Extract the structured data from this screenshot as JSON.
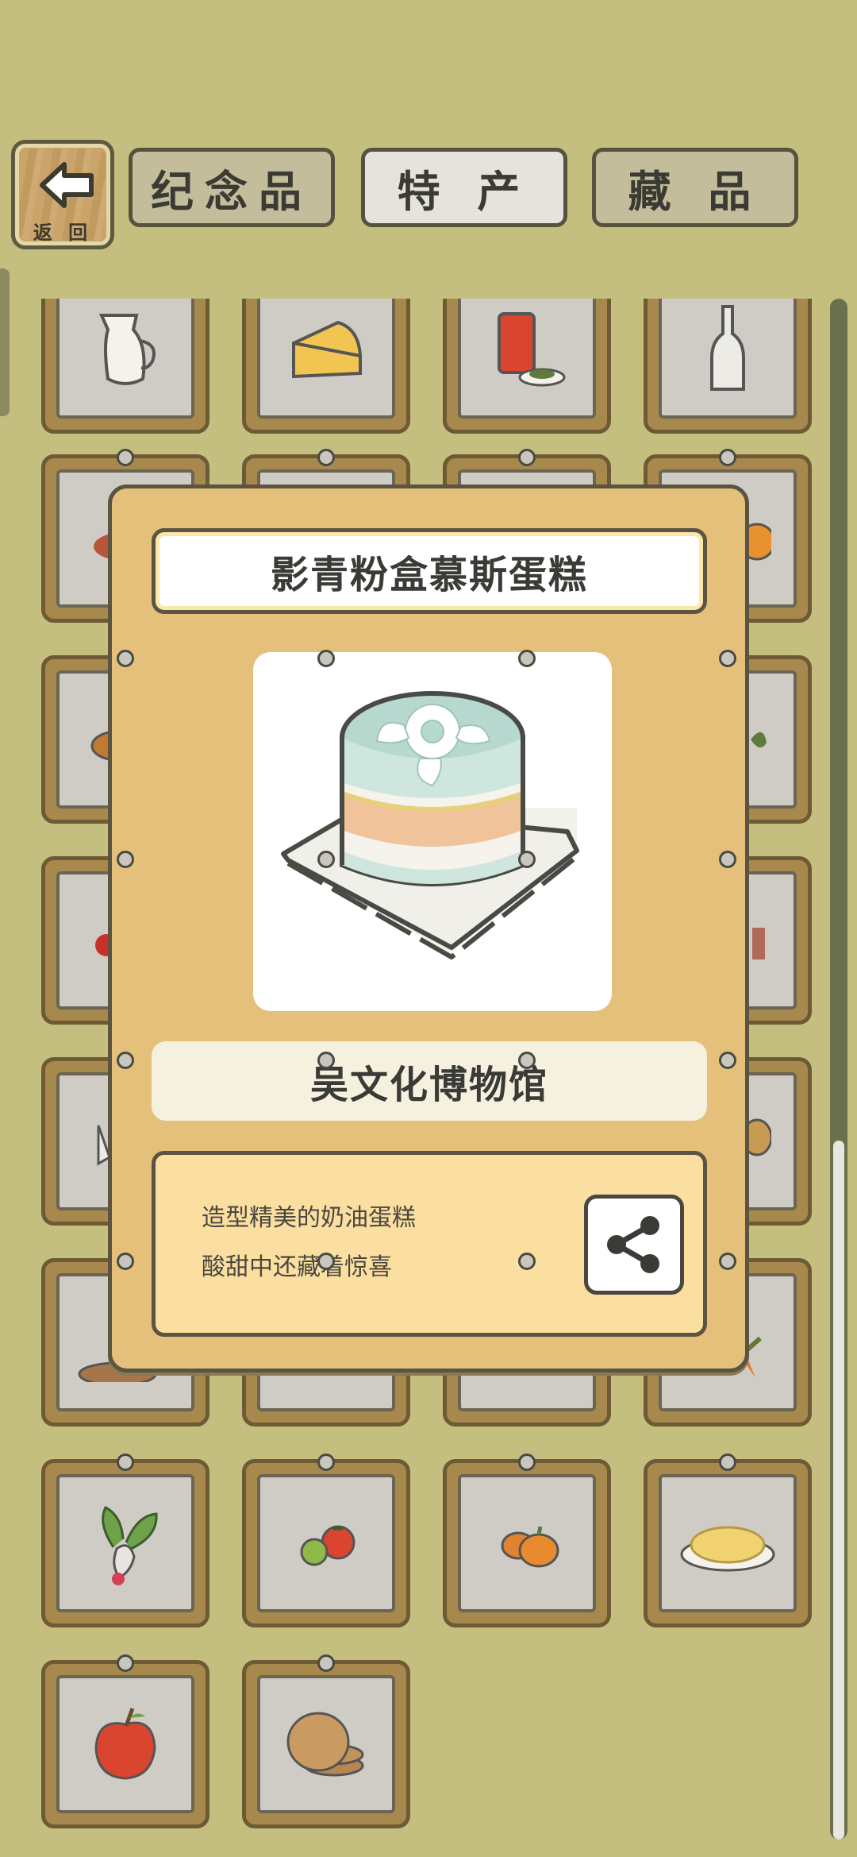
{
  "header": {
    "back_label": "返 回",
    "tabs": [
      {
        "label": "纪念品",
        "state": "inactive"
      },
      {
        "label": "特 产",
        "state": "active"
      },
      {
        "label": "藏 品",
        "state": "inactive"
      }
    ]
  },
  "grid": {
    "items": [
      "milk-jug-icon",
      "cheese-icon",
      "tea-tin-icon",
      "glass-bottle-icon",
      "tomato-dish-icon",
      "blank",
      "blank",
      "orange-icon",
      "soup-bowl-icon",
      "blank",
      "blank",
      "leaf-icon",
      "cherry-icon",
      "blank",
      "blank",
      "box-icon",
      "cloth-bag-icon",
      "blank",
      "blank",
      "basket-icon",
      "bread-icon",
      "blank",
      "blank",
      "carrot-icon",
      "radish-icon",
      "tomatoes-icon",
      "pumpkins-icon",
      "noodles-plate-icon",
      "apple-icon",
      "pancakes-icon"
    ]
  },
  "popup": {
    "title": "影青粉盒慕斯蛋糕",
    "image": "mousse-cake-icon",
    "location": "吴文化博物馆",
    "description_lines": [
      "造型精美的奶油蛋糕",
      "酸甜中还藏着惊喜"
    ],
    "share_icon": "share-icon"
  },
  "colors": {
    "background": "#c4bf7e",
    "popup_bg": "#e5c07a",
    "desc_bg": "#fbdfa0",
    "cell_frame": "#a8894d"
  }
}
